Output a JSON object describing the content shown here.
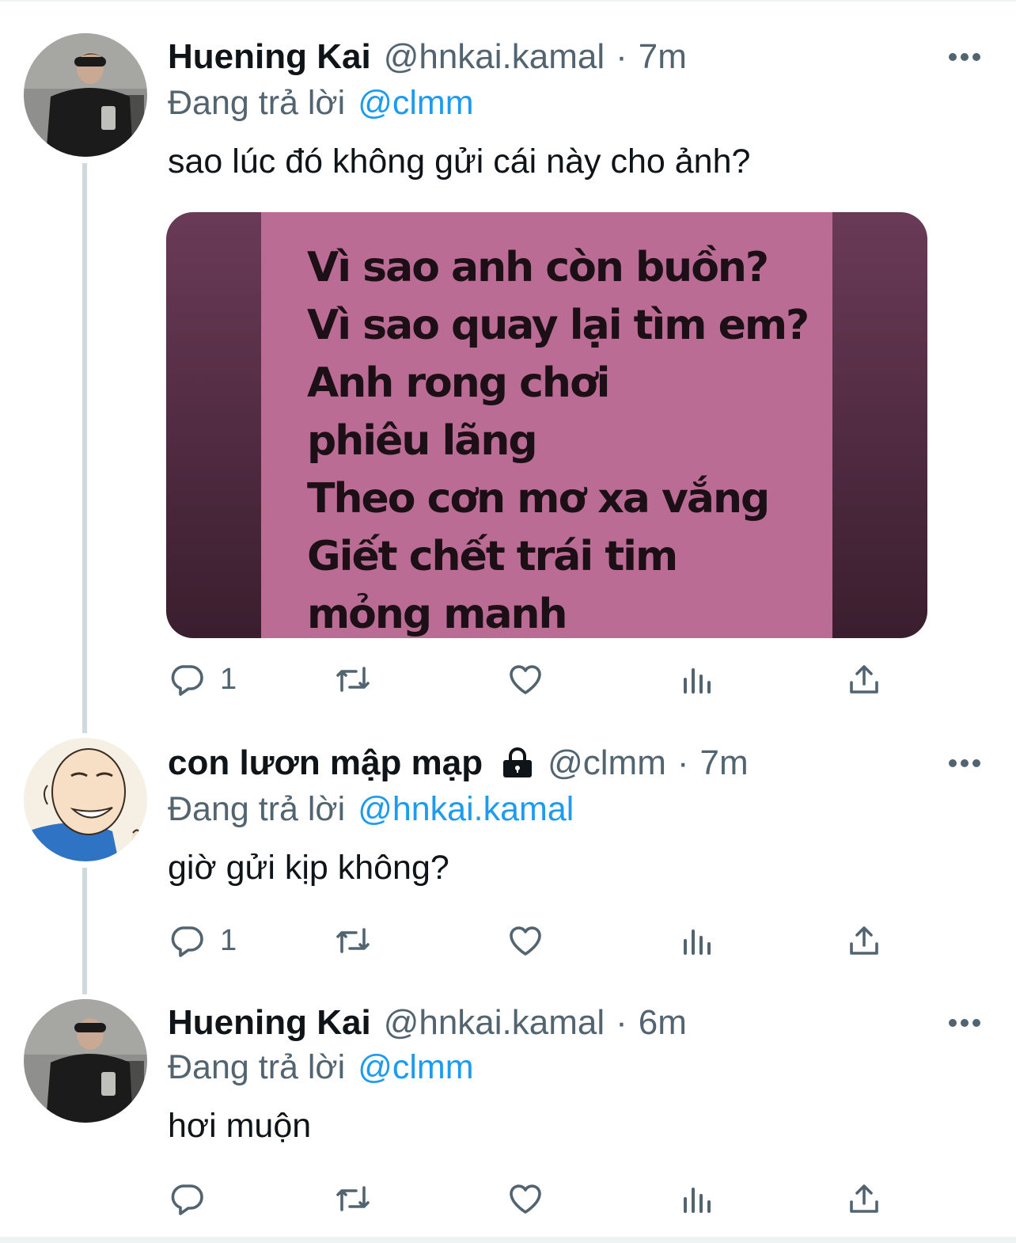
{
  "tweets": [
    {
      "display_name": "Huening Kai",
      "handle": "@hnkai.kamal",
      "separator": "·",
      "time": "7m",
      "replying_label": "Đang trả lời",
      "replying_to": "@clmm",
      "text": "sao lúc đó không gửi cái này cho ảnh?",
      "reply_count": "1",
      "media": {
        "lines": [
          "Vì sao anh còn buồn?",
          "Vì sao quay lại tìm em?",
          "Anh rong chơi",
          "phiêu lãng",
          "Theo cơn mơ xa vắng",
          "Giết chết trái tim",
          "mỏng manh"
        ],
        "background_color": "#bb6c94",
        "frame_color": "#4a2638"
      }
    },
    {
      "display_name": "con lươn mập mạp",
      "locked": true,
      "handle": "@clmm",
      "separator": "·",
      "time": "7m",
      "replying_label": "Đang trả lời",
      "replying_to": "@hnkai.kamal",
      "text": "giờ gửi kịp không?",
      "reply_count": "1"
    },
    {
      "display_name": "Huening Kai",
      "handle": "@hnkai.kamal",
      "separator": "·",
      "time": "6m",
      "replying_label": "Đang trả lời",
      "replying_to": "@clmm",
      "text": "hơi muộn",
      "reply_count": ""
    }
  ],
  "icons": {
    "reply": "reply-icon",
    "retweet": "retweet-icon",
    "like": "heart-icon",
    "views": "views-icon",
    "share": "share-icon",
    "more": "more-icon",
    "lock": "lock-icon"
  },
  "colors": {
    "mention": "#1d9bf0",
    "secondary_text": "#536471",
    "thread_line": "#cfd9de"
  }
}
